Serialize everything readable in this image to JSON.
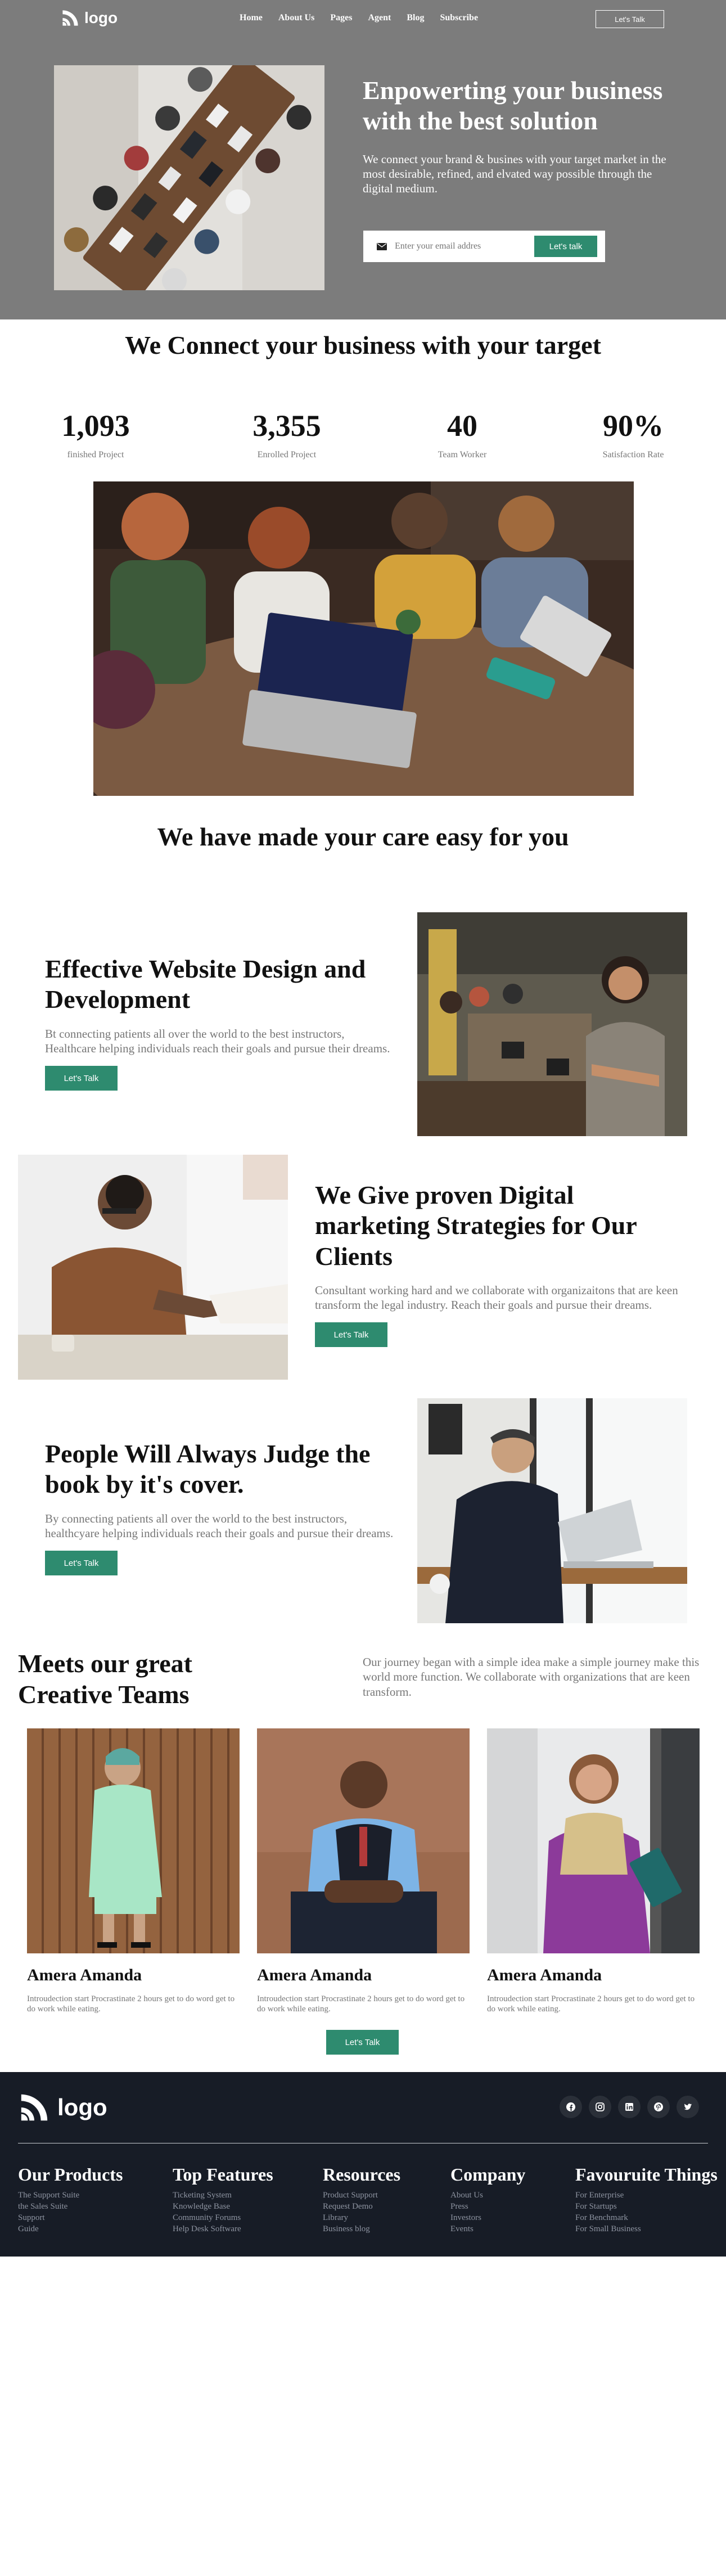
{
  "nav": {
    "logo": "logo",
    "links": [
      "Home",
      "About Us",
      "Pages",
      "Agent",
      "Blog",
      "Subscribe"
    ],
    "cta": "Let's Talk"
  },
  "hero": {
    "title": "Enpowerting your business with the best solution",
    "desc": "We connect your brand & busines with your target market in the most desirable, refined, and elvated way possible through the digital medium.",
    "email_placeholder": "Enter your email addres",
    "subscribe_btn": "Let's talk"
  },
  "connect": {
    "title": "We Connect your business with your target"
  },
  "stats": [
    {
      "value": "1,093",
      "label": "finished Project"
    },
    {
      "value": "3,355",
      "label": "Enrolled Project"
    },
    {
      "value": "40",
      "label": "Team Worker"
    },
    {
      "value": "90%",
      "label": "Satisfaction Rate"
    }
  ],
  "care": {
    "title": "We have made your care easy for you"
  },
  "features": [
    {
      "title": "Effective Website Design and Development",
      "desc": "Bt connecting patients all over the world to the best instructors, Healthcare helping individuals reach their goals and pursue their dreams.",
      "btn": "Let's Talk"
    },
    {
      "title": "We Give proven Digital marketing Strategies for Our Clients",
      "desc": "Consultant working hard and we collaborate with organizaitons that are keen transform the legal industry. Reach their goals and pursue their dreams.",
      "btn": "Let's Talk"
    },
    {
      "title": "People Will Always Judge the book by it's cover.",
      "desc": "By connecting patients all over the world to the best instructors, healthcyare helping individuals reach their goals and pursue their dreams.",
      "btn": "Let's Talk"
    }
  ],
  "team": {
    "title": "Meets our great Creative Teams",
    "desc": "Our journey began with a simple idea make a simple journey make this world more function. We collaborate with organizations that are keen transform.",
    "members": [
      {
        "name": "Amera Amanda",
        "intro": "Introudection start Procrastinate 2 hours get to do word get to do work while eating."
      },
      {
        "name": "Amera Amanda",
        "intro": "Introudection start Procrastinate 2 hours get to do word get to do work while eating."
      },
      {
        "name": "Amera Amanda",
        "intro": "Introudection start Procrastinate 2 hours get to do word get to do work while eating."
      }
    ],
    "btn": "Let's Talk"
  },
  "footer": {
    "logo": "logo",
    "socials": [
      "facebook-icon",
      "instagram-icon",
      "linkedin-icon",
      "pinterest-icon",
      "twitter-icon"
    ],
    "columns": [
      {
        "title": "Our Products",
        "links": [
          "The Support Suite",
          "the Sales Suite",
          "Support",
          "Guide"
        ]
      },
      {
        "title": "Top Features",
        "links": [
          "Ticketing System",
          "Knowledge Base",
          "Community Forums",
          "Help Desk Software"
        ]
      },
      {
        "title": "Resources",
        "links": [
          "Product Support",
          "Request Demo",
          "Library",
          "Business blog"
        ]
      },
      {
        "title": "Company",
        "links": [
          "About Us",
          "Press",
          "Investors",
          "Events"
        ]
      },
      {
        "title": "Favouruite Things",
        "links": [
          "For Enterprise",
          "For Startups",
          "For Benchmark",
          "For Small Business"
        ]
      }
    ]
  },
  "colors": {
    "hero_bg": "#7c7c7c",
    "accent": "#2e8b6f",
    "footer_bg": "#171c26",
    "muted_text": "#777777"
  }
}
